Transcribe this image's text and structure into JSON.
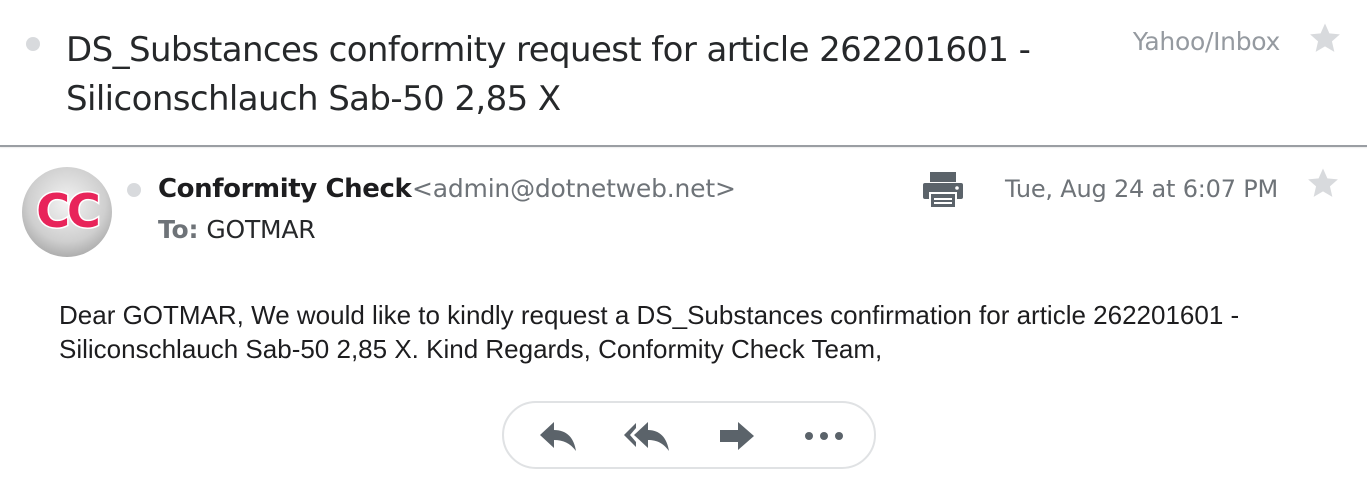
{
  "subject": {
    "text": "DS_Substances conformity request for article 262201601 - Siliconschlauch Sab-50 2,85 X",
    "folder": "Yahoo/Inbox"
  },
  "message": {
    "avatar_initials": "CC",
    "sender_name": "Conformity Check",
    "sender_email": "<admin@dotnetweb.net>",
    "to_label": "To:",
    "to_value": "GOTMAR",
    "date": "Tue, Aug 24 at 6:07 PM",
    "body": "Dear GOTMAR, We would like to kindly request a DS_Substances confirmation for article 262201601 - Siliconschlauch Sab-50 2,85 X. Kind Regards, Conformity Check Team,"
  },
  "icons": {
    "unread": "unread-dot-icon",
    "star": "star-icon",
    "print": "printer-icon",
    "reply": "reply-icon",
    "reply_all": "reply-all-icon",
    "forward": "forward-icon",
    "more": "more-dots-icon"
  },
  "colors": {
    "text_primary": "#26282a",
    "text_muted": "#6e7378",
    "icon_gray": "#5b636a",
    "star_gray": "#d8dadd",
    "avatar_red": "#e8245a"
  }
}
